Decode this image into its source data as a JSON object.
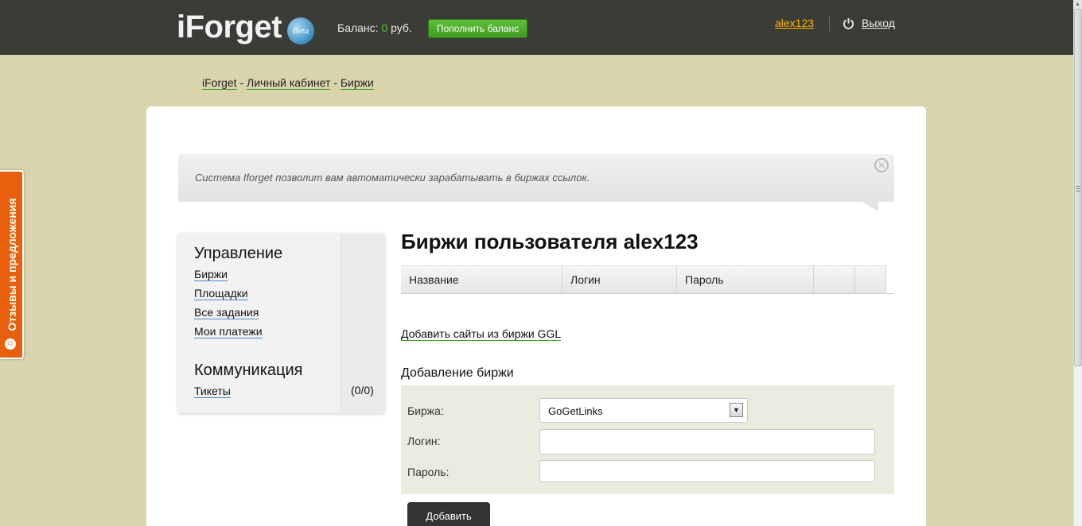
{
  "header": {
    "logo_text": "iForget",
    "logo_badge": "Beta",
    "balance_label": "Баланс: ",
    "balance_amount": "0",
    "balance_currency": " руб.",
    "topup_label": "Пополнить баланс",
    "username": "alex123",
    "logout_label": "Выход"
  },
  "breadcrumb": {
    "items": [
      "iForget",
      "Личный кабинет",
      "Биржи"
    ],
    "separator": " - "
  },
  "notice": {
    "text": "Система Iforget позволит вам автоматически зарабатывать в биржах ссылок.",
    "close_glyph": "✕"
  },
  "sidebar": {
    "heading_management": "Управление",
    "management_items": [
      "Биржи",
      "Площадки",
      "Все задания",
      "Мои платежи"
    ],
    "heading_communication": "Коммуникация",
    "communication_items": [
      "Тикеты"
    ],
    "tickets_count": "(0/0)"
  },
  "main": {
    "title": "Биржи пользователя alex123",
    "table_headers": [
      "Название",
      "Логин",
      "Пароль",
      "",
      ""
    ],
    "add_ggl_link": "Добавить сайты из биржи GGL",
    "add_section_title": "Добавление биржи",
    "form": {
      "exchange_label": "Биржа:",
      "exchange_value": "GoGetLinks",
      "login_label": "Логин:",
      "login_value": "",
      "password_label": "Пароль:",
      "password_value": "",
      "submit_label": "Добавить"
    }
  },
  "feedback_tab": {
    "label": "Отзывы и предложения"
  },
  "colors": {
    "topbar": "#3b3b38",
    "accent_yellow": "#f5b800",
    "accent_green": "#5fc03a",
    "feedback_orange": "#e8600e"
  }
}
